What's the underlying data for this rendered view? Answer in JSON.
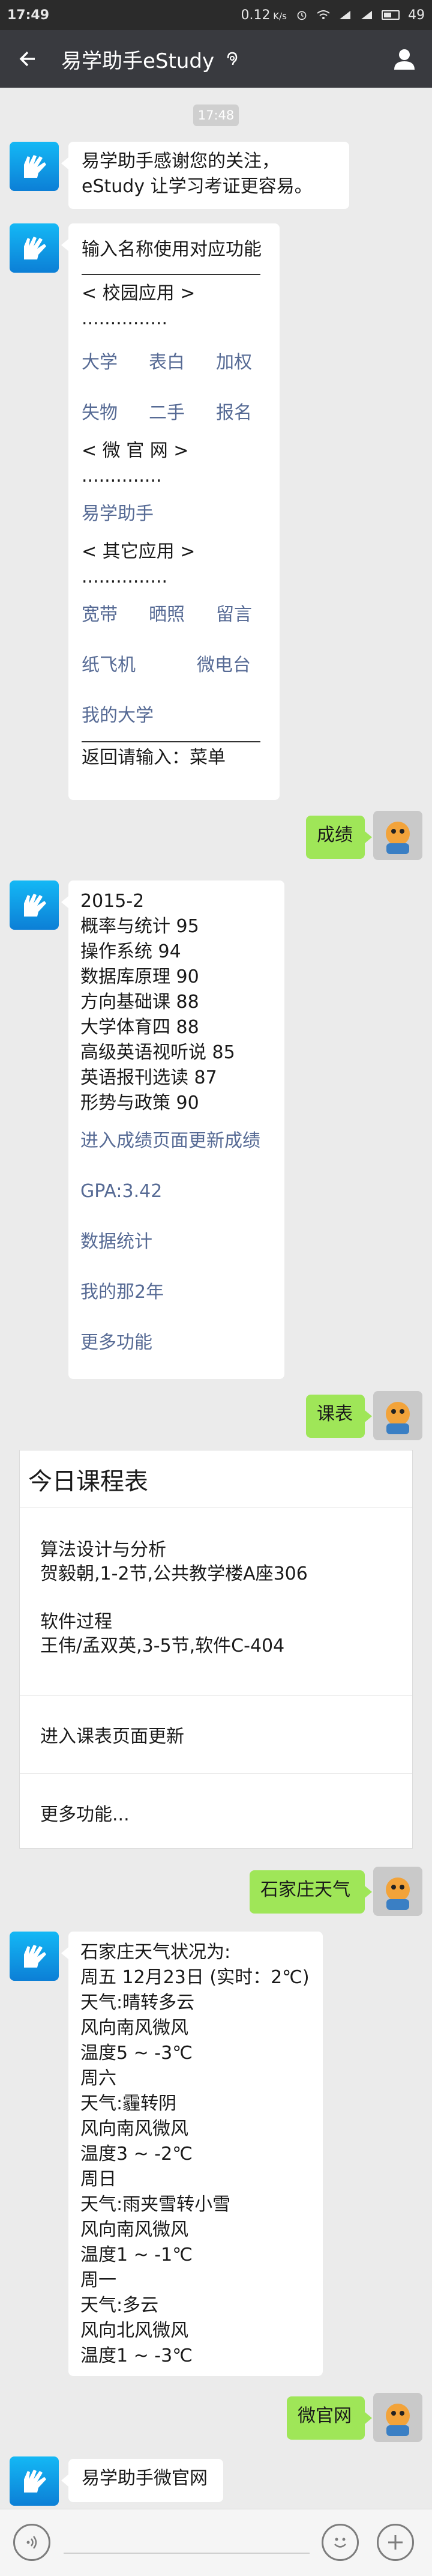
{
  "status_bar": {
    "time": "17:49",
    "speed": "0.12",
    "battery": "49"
  },
  "header": {
    "title": "易学助手eStudy"
  },
  "chat": {
    "timestamp": "17:48",
    "welcome": {
      "line1": "易学助手感谢您的关注，",
      "line2": "eStudy 让学习考证更容易。"
    },
    "menu": {
      "intro": "输入名称使用对应功能",
      "campus_header": "< 校园应用 > ...............",
      "campus_items": [
        "大学",
        "表白",
        "加权",
        "失物",
        "二手",
        "报名"
      ],
      "official_header": "< 微 官 网 > ..............",
      "official_items": [
        "易学助手"
      ],
      "other_header": "< 其它应用 > ...............",
      "other_items": [
        "宽带",
        "晒照",
        "留言",
        "纸飞机",
        "微电台",
        "我的大学"
      ],
      "footer": "返回请输入：菜单"
    },
    "user_msg_1": "成绩",
    "grades": {
      "term": "2015-2",
      "lines": [
        "概率与统计 95",
        "操作系统 94",
        "数据库原理 90",
        "方向基础课 88",
        "大学体育四 88",
        "高级英语视听说 85",
        "英语报刊选读 87",
        "形势与政策 90"
      ],
      "links": [
        "进入成绩页面更新成绩",
        "GPA:3.42",
        "数据统计",
        "我的那2年",
        "更多功能"
      ]
    },
    "user_msg_2": "课表",
    "course_card": {
      "title": "今日课程表",
      "course1_name": "算法设计与分析",
      "course1_detail": "贺毅朝,1-2节,公共教学楼A座306",
      "course2_name": "软件过程",
      "course2_detail": "王伟/孟双英,3-5节,软件C-404",
      "update_link": "进入课表页面更新",
      "more_link": "更多功能..."
    },
    "user_msg_3": "石家庄天气",
    "weather": {
      "lines": [
        "石家庄天气状况为:",
        "周五 12月23日 (实时：2℃)",
        "天气:晴转多云",
        "风向南风微风",
        "温度5 ~ -3℃",
        "周六",
        "天气:霾转阴",
        "风向南风微风",
        "温度3 ~ -2℃",
        "周日",
        "天气:雨夹雪转小雪",
        "风向南风微风",
        "温度1 ~ -1℃",
        "周一",
        "天气:多云",
        "风向北风微风",
        "温度1 ~ -3℃"
      ]
    },
    "user_msg_4": "微官网",
    "site_reply": "易学助手微官网"
  },
  "colors": {
    "title_bar": "#393a3f",
    "status_bar": "#2b2b2b",
    "user_bubble": "#9fe658",
    "link": "#576b95",
    "background": "#ebebeb"
  }
}
